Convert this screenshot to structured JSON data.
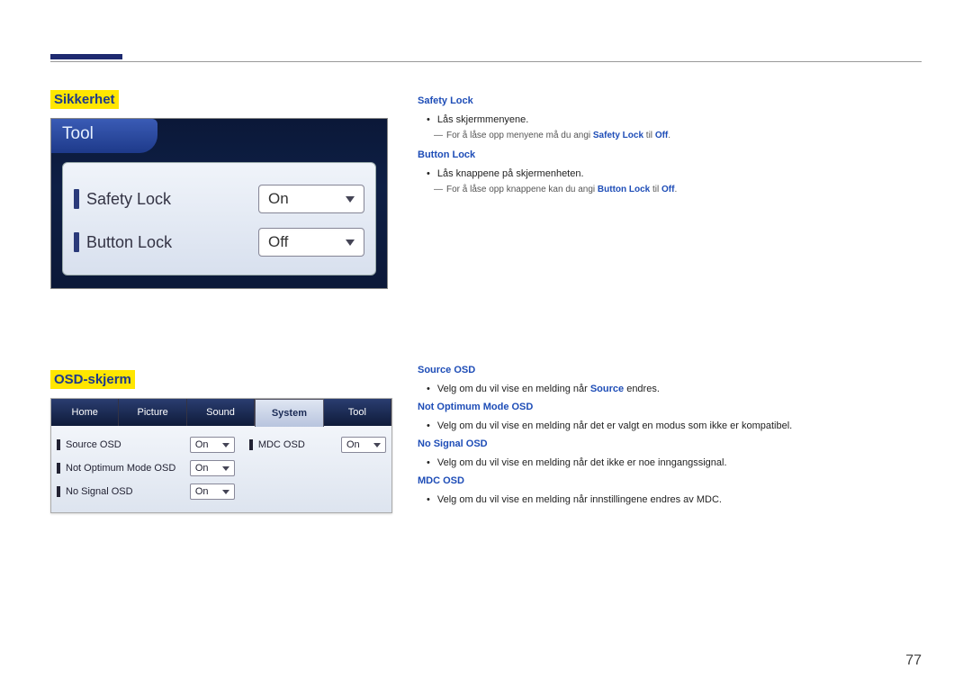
{
  "page_number": "77",
  "section1": {
    "heading": "Sikkerhet",
    "panel_title": "Tool",
    "rows": [
      {
        "label": "Safety Lock",
        "value": "On"
      },
      {
        "label": "Button Lock",
        "value": "Off"
      }
    ],
    "right": {
      "safety_lock": {
        "title": "Safety Lock",
        "bullet": "Lås skjermmenyene.",
        "hint_pre": "For å låse opp menyene må du angi ",
        "hint_b1": "Safety Lock",
        "hint_mid": " til ",
        "hint_b2": "Off",
        "hint_post": "."
      },
      "button_lock": {
        "title": "Button Lock",
        "bullet": "Lås knappene på skjermenheten.",
        "hint_pre": "For å låse opp knappene kan du angi ",
        "hint_b1": "Button Lock",
        "hint_mid": " til ",
        "hint_b2": "Off",
        "hint_post": "."
      }
    }
  },
  "section2": {
    "heading": "OSD-skjerm",
    "tabs": [
      "Home",
      "Picture",
      "Sound",
      "System",
      "Tool"
    ],
    "active_tab": "System",
    "left_rows": [
      {
        "label": "Source OSD",
        "value": "On"
      },
      {
        "label": "Not Optimum Mode OSD",
        "value": "On"
      },
      {
        "label": "No Signal OSD",
        "value": "On"
      }
    ],
    "right_rows": [
      {
        "label": "MDC OSD",
        "value": "On"
      }
    ],
    "right": {
      "source": {
        "title": "Source OSD",
        "bullet_pre": "Velg om du vil vise en melding når ",
        "bullet_b": "Source",
        "bullet_post": " endres."
      },
      "notopt": {
        "title": "Not Optimum Mode OSD",
        "bullet": "Velg om du vil vise en melding når det er valgt en modus som ikke er kompatibel."
      },
      "nosig": {
        "title": "No Signal OSD",
        "bullet": "Velg om du vil vise en melding når det ikke er noe inngangssignal."
      },
      "mdc": {
        "title": "MDC OSD",
        "bullet": "Velg om du vil vise en melding når innstillingene endres av MDC."
      }
    }
  }
}
